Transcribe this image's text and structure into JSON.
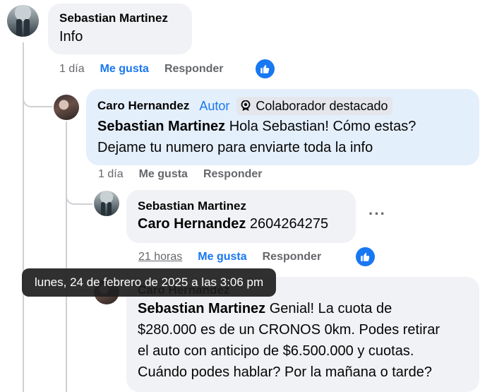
{
  "comments": [
    {
      "author": "Sebastian Martinez",
      "text": "Info",
      "time": "1 día",
      "like_label": "Me gusta",
      "reply_label": "Responder"
    },
    {
      "author": "Caro Hernandez",
      "author_tag": "Autor",
      "badge": "Colaborador destacado",
      "mention": "Sebastian Martinez",
      "text_line1": " Hola Sebastian! Cómo estas?",
      "text_line2": "Dejame tu numero para enviarte toda la info",
      "time": "1 día",
      "like_label": "Me gusta",
      "reply_label": "Responder"
    },
    {
      "author": "Sebastian Martinez",
      "mention": "Caro Hernandez",
      "text": " 2604264275",
      "time": "21 horas",
      "like_label": "Me gusta",
      "reply_label": "Responder",
      "more": "···"
    },
    {
      "author": "Caro Hernandez",
      "mention": "Sebastian Martinez",
      "text_line1": " Genial! La cuota de",
      "text_line2": "$280.000 es de un CRONOS 0km. Podes retirar",
      "text_line3": "el auto con anticipo de $6.500.000 y cuotas.",
      "text_line4": "Cuándo podes hablar? Por la mañana o tarde?"
    }
  ],
  "tooltip": "lunes, 24 de febrero de 2025 a las 3:06 pm",
  "colors": {
    "accent": "#1877f2",
    "bubble": "#f0f2f5",
    "highlight_bubble": "#e4effc"
  },
  "icons": {
    "like_badge": "thumbs-up-icon",
    "top_contributor": "star-badge-icon"
  }
}
